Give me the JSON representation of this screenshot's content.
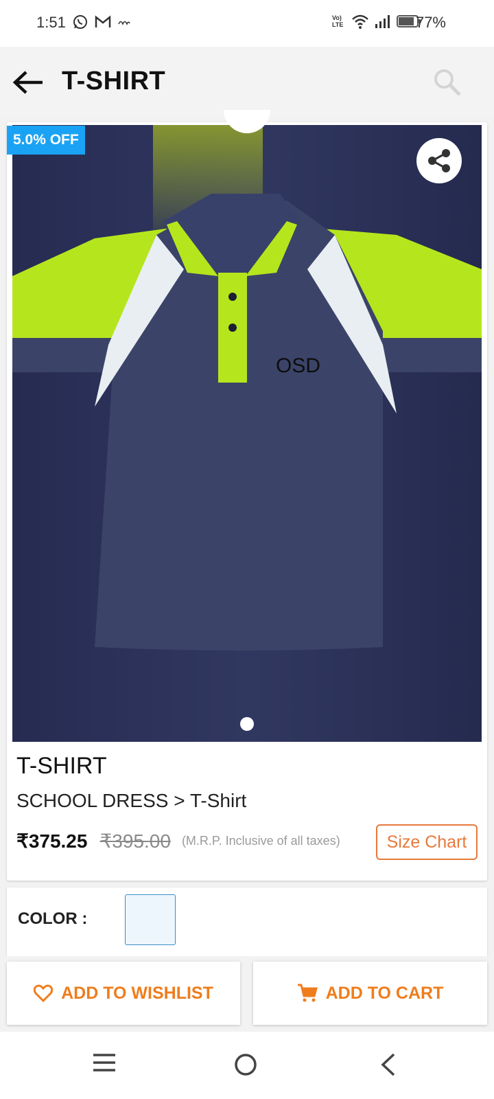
{
  "status_bar": {
    "time": "1:51",
    "battery_percent": "77%",
    "network_label": "Vo) LTE"
  },
  "app_bar": {
    "title": "T-SHIRT",
    "back_icon": "arrow-left-icon",
    "search_icon": "search-icon"
  },
  "product": {
    "discount_badge": "5.0% OFF",
    "image_print": "OSD",
    "name": "T-SHIRT",
    "breadcrumb": "SCHOOL DRESS > T-Shirt",
    "price": "₹375.25",
    "mrp": "₹395.00",
    "tax_note": "(M.R.P. Inclusive of all taxes)",
    "size_chart_label": "Size Chart",
    "image_count": 1,
    "active_image_index": 0
  },
  "color": {
    "label": "COLOR :",
    "selected_swatch": "#eef6fd"
  },
  "actions": {
    "wishlist_label": "ADD TO WISHLIST",
    "cart_label": "ADD TO CART"
  },
  "colors": {
    "accent": "#ef7d1c",
    "badge": "#1aa3f4",
    "shirt_navy": "#3b4468",
    "shirt_lime": "#b5e61d"
  }
}
